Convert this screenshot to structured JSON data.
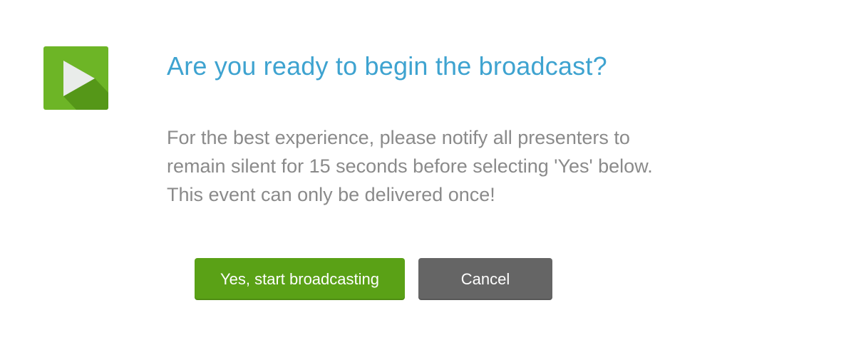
{
  "dialog": {
    "title": "Are you ready to begin the broadcast?",
    "message_lines": [
      "For the best experience, please notify all presenters to",
      "remain silent for 15 seconds before selecting 'Yes' below.",
      "This event can only be delivered once!"
    ],
    "icon": "play-icon",
    "buttons": {
      "confirm_label": "Yes, start broadcasting",
      "cancel_label": "Cancel"
    }
  },
  "colors": {
    "title": "#3ea3d0",
    "text": "#8a8a8a",
    "icon_green": "#6db526",
    "confirm_button": "#5aa116",
    "cancel_button": "#656565"
  }
}
